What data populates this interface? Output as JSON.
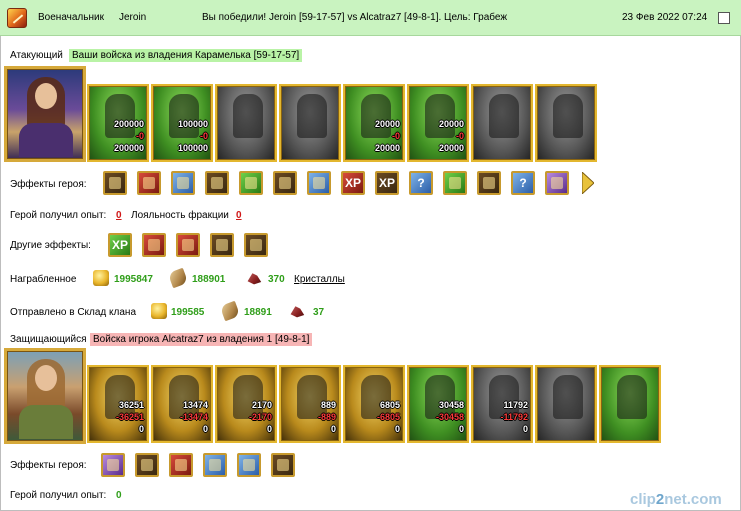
{
  "header": {
    "role": "Военачальник",
    "player": "Jeroin",
    "result": "Вы победили! Jeroin [59-17-57] vs Alcatraz7 [49-8-1]. Цель: Грабеж",
    "datetime": "23 Фев 2022 07:24"
  },
  "attacker": {
    "label": "Атакующий",
    "desc": "Ваши войска из владения Карамелька [59-17-57]",
    "units": [
      {
        "a": "200000",
        "b": "-0",
        "c": "200000",
        "style": "green"
      },
      {
        "a": "100000",
        "b": "-0",
        "c": "100000",
        "style": "green"
      },
      {
        "a": "",
        "b": "",
        "c": "",
        "style": "gray"
      },
      {
        "a": "",
        "b": "",
        "c": "",
        "style": "gray"
      },
      {
        "a": "20000",
        "b": "-0",
        "c": "20000",
        "style": "green"
      },
      {
        "a": "20000",
        "b": "-0",
        "c": "20000",
        "style": "green"
      },
      {
        "a": "",
        "b": "",
        "c": "",
        "style": "gray"
      },
      {
        "a": "",
        "b": "",
        "c": "",
        "style": "gray"
      }
    ],
    "effects_label": "Эффекты героя:",
    "effects": [
      {
        "icon": "treasure-chest-icon",
        "glyph": "",
        "style": ""
      },
      {
        "icon": "dice-icon",
        "glyph": "",
        "style": "redbg"
      },
      {
        "icon": "shield-icon",
        "glyph": "",
        "style": "blue"
      },
      {
        "icon": "handshake-icon",
        "glyph": "",
        "style": ""
      },
      {
        "icon": "sword-icon",
        "glyph": "",
        "style": "greenbg"
      },
      {
        "icon": "hand-icon",
        "glyph": "",
        "style": ""
      },
      {
        "icon": "crystal-hand-icon",
        "glyph": "",
        "style": "blue"
      },
      {
        "icon": "xp-icon",
        "glyph": "XP",
        "style": "redbg"
      },
      {
        "icon": "xp-scroll-icon",
        "glyph": "XP",
        "style": ""
      },
      {
        "icon": "question-icon",
        "glyph": "?",
        "style": "blue"
      },
      {
        "icon": "gem-icon",
        "glyph": "",
        "style": "greenbg"
      },
      {
        "icon": "fortress-icon",
        "glyph": "",
        "style": ""
      },
      {
        "icon": "question-icon",
        "glyph": "?",
        "style": "blue"
      },
      {
        "icon": "ring-icon",
        "glyph": "",
        "style": "violet"
      }
    ],
    "exp_label": "Герой получил опыт:",
    "exp_value": "0",
    "loyalty_label": "Лояльность фракции",
    "loyalty_value": "0",
    "other_label": "Другие эффекты:",
    "other_effects": [
      {
        "icon": "xp-icon",
        "glyph": "XP",
        "style": "greenbg"
      },
      {
        "icon": "hearts-icon",
        "glyph": "",
        "style": "redbg"
      },
      {
        "icon": "fist-icon",
        "glyph": "",
        "style": "redbg"
      },
      {
        "icon": "sword-hand-icon",
        "glyph": "",
        "style": ""
      },
      {
        "icon": "bag-icon",
        "glyph": "",
        "style": ""
      }
    ]
  },
  "loot": {
    "label": "Награбленное",
    "gold": "1995847",
    "wood": "188901",
    "crystals": "370",
    "crystals_link": "Кристаллы"
  },
  "clan": {
    "label": "Отправлено в Склад клана",
    "gold": "199585",
    "wood": "18891",
    "crystals": "37"
  },
  "defender": {
    "label": "Защищающийся",
    "desc": "Войска игрока Alcatraz7 из владения 1 [49-8-1]",
    "units": [
      {
        "a": "36251",
        "b": "-36251",
        "c": "0",
        "style": "gold"
      },
      {
        "a": "13474",
        "b": "-13474",
        "c": "0",
        "style": "gold"
      },
      {
        "a": "2170",
        "b": "-2170",
        "c": "0",
        "style": "gold"
      },
      {
        "a": "889",
        "b": "-889",
        "c": "0",
        "style": "gold"
      },
      {
        "a": "6805",
        "b": "-6805",
        "c": "0",
        "style": "gold"
      },
      {
        "a": "30458",
        "b": "-30458",
        "c": "0",
        "style": "green"
      },
      {
        "a": "11792",
        "b": "-11792",
        "c": "0",
        "style": "gray"
      },
      {
        "a": "",
        "b": "",
        "c": "",
        "style": "gray"
      },
      {
        "a": "",
        "b": "",
        "c": "",
        "style": "green"
      }
    ],
    "effects_label": "Эффекты героя:",
    "effects": [
      {
        "icon": "gift-icon",
        "glyph": "",
        "style": "violet"
      },
      {
        "icon": "scroll-icon",
        "glyph": "",
        "style": ""
      },
      {
        "icon": "shield-icon",
        "glyph": "",
        "style": "redbg"
      },
      {
        "icon": "staff-icon",
        "glyph": "",
        "style": "blue"
      },
      {
        "icon": "crossed-swords-icon",
        "glyph": "",
        "style": "blue"
      },
      {
        "icon": "hammer-icon",
        "glyph": "",
        "style": ""
      }
    ],
    "exp_label": "Герой получил опыт:",
    "exp_value": "0"
  },
  "watermark": {
    "main": "clip",
    "accent": "2",
    "tail": "net.com"
  }
}
